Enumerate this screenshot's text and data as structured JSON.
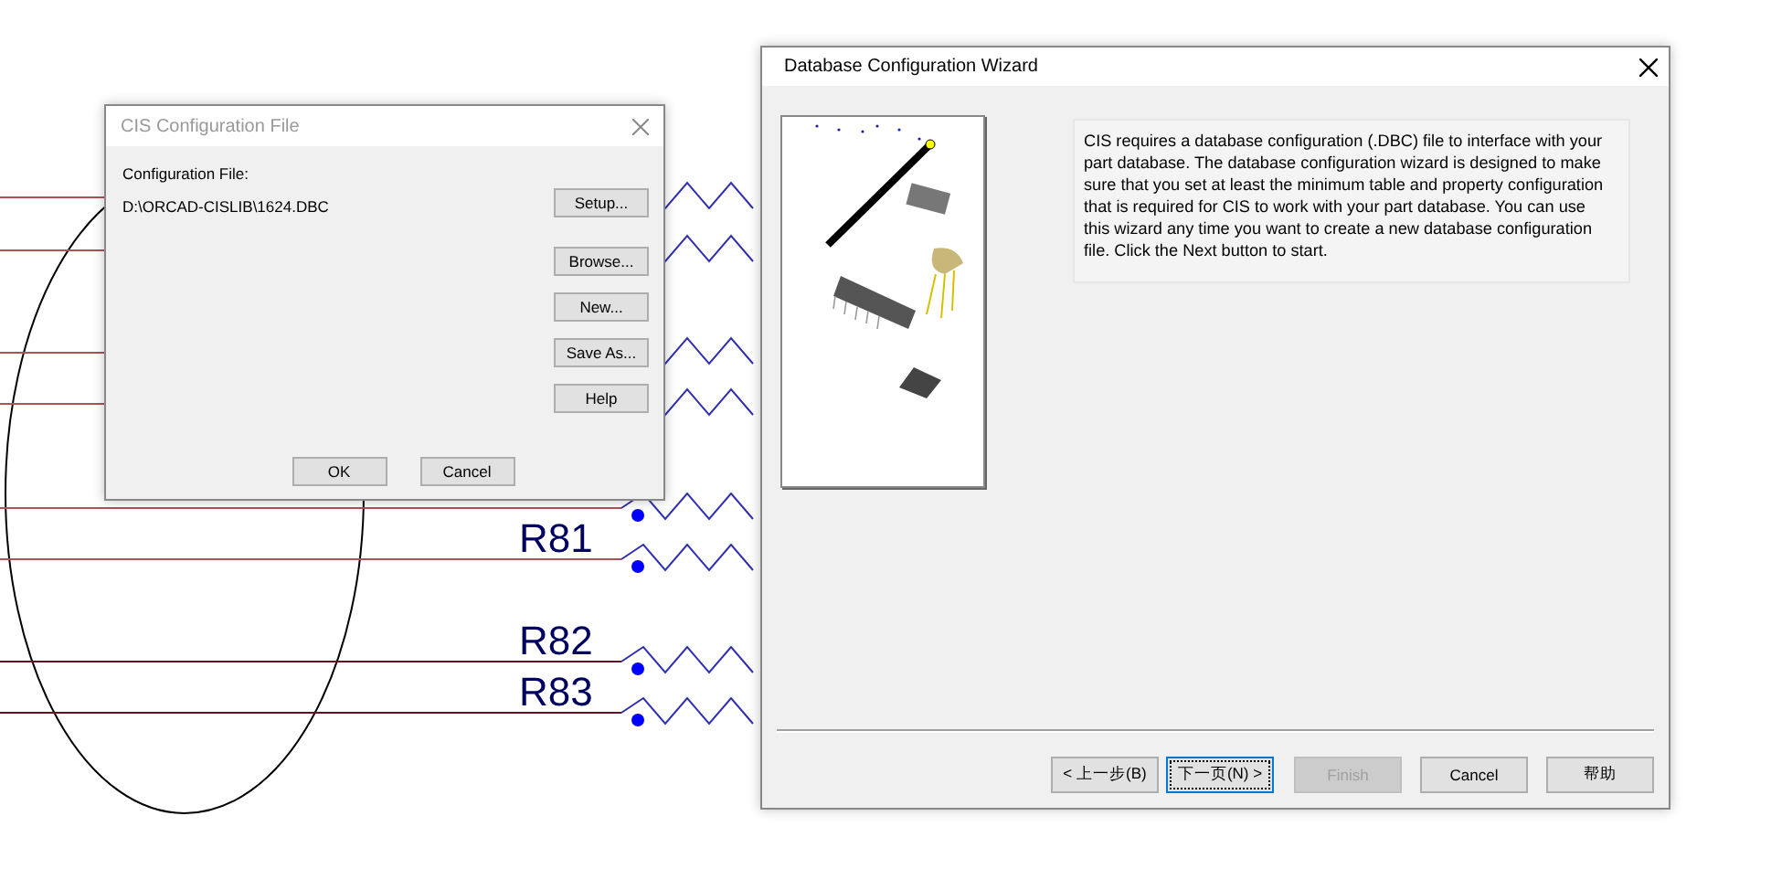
{
  "schematic": {
    "labels": [
      "R81",
      "R82",
      "R83"
    ]
  },
  "cis_dialog": {
    "title": "CIS Configuration File",
    "active": false,
    "label": "Configuration File:",
    "path": "D:\\ORCAD-CISLIB\\1624.DBC",
    "side_buttons": [
      {
        "label": "Setup..."
      },
      {
        "label": "Browse..."
      },
      {
        "label": "New..."
      },
      {
        "label": "Save As..."
      },
      {
        "label": "Help"
      }
    ],
    "buttons": [
      {
        "label": "OK"
      },
      {
        "label": "Cancel"
      }
    ]
  },
  "wizard": {
    "title": "Database Configuration Wizard",
    "active": true,
    "description": "CIS requires a database configuration (.DBC) file to interface with your part database. The database configuration wizard is designed to make sure that you set at least the minimum table and property configuration that is required for CIS to work with your part database. You can use this wizard any time you want to create a new database configuration file. Click the Next button to start.",
    "buttons": [
      {
        "label": "< 上一步(B)",
        "disabled": false,
        "focused": false
      },
      {
        "label": "下一页(N) >",
        "disabled": false,
        "focused": true
      },
      {
        "label": "Finish",
        "disabled": true,
        "focused": false
      },
      {
        "label": "Cancel",
        "disabled": false,
        "focused": false
      },
      {
        "label": "帮助",
        "disabled": false,
        "focused": false
      }
    ]
  }
}
